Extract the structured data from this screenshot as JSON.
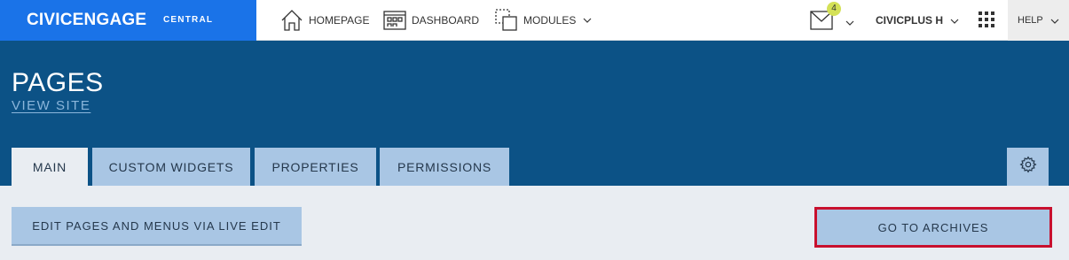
{
  "brand": {
    "name": "CIVICENGAGE",
    "sub": "CENTRAL",
    "color": "#1a73e8"
  },
  "nav": {
    "homepage": {
      "label": "HOMEPAGE",
      "icon": "house-icon"
    },
    "dashboard": {
      "label": "DASHBOARD",
      "icon": "dashboard-icon"
    },
    "modules": {
      "label": "MODULES",
      "icon": "modules-icon"
    }
  },
  "notifications": {
    "count": "4",
    "icon": "envelope-icon",
    "badge_color": "#d4e157"
  },
  "user": {
    "label": "CIVICPLUS H"
  },
  "apps": {
    "icon": "grid-icon"
  },
  "help": {
    "label": "HELP"
  },
  "header": {
    "title": "PAGES",
    "view_site": "VIEW SITE",
    "background": "#0c5286"
  },
  "tabs": [
    {
      "label": "MAIN",
      "active": true
    },
    {
      "label": "CUSTOM WIDGETS",
      "active": false
    },
    {
      "label": "PROPERTIES",
      "active": false
    },
    {
      "label": "PERMISSIONS",
      "active": false
    }
  ],
  "settings": {
    "icon": "gear-icon"
  },
  "actions": {
    "live_edit": "EDIT PAGES AND MENUS VIA LIVE EDIT",
    "archives": "GO TO ARCHIVES",
    "highlight_color": "#c8102e"
  }
}
